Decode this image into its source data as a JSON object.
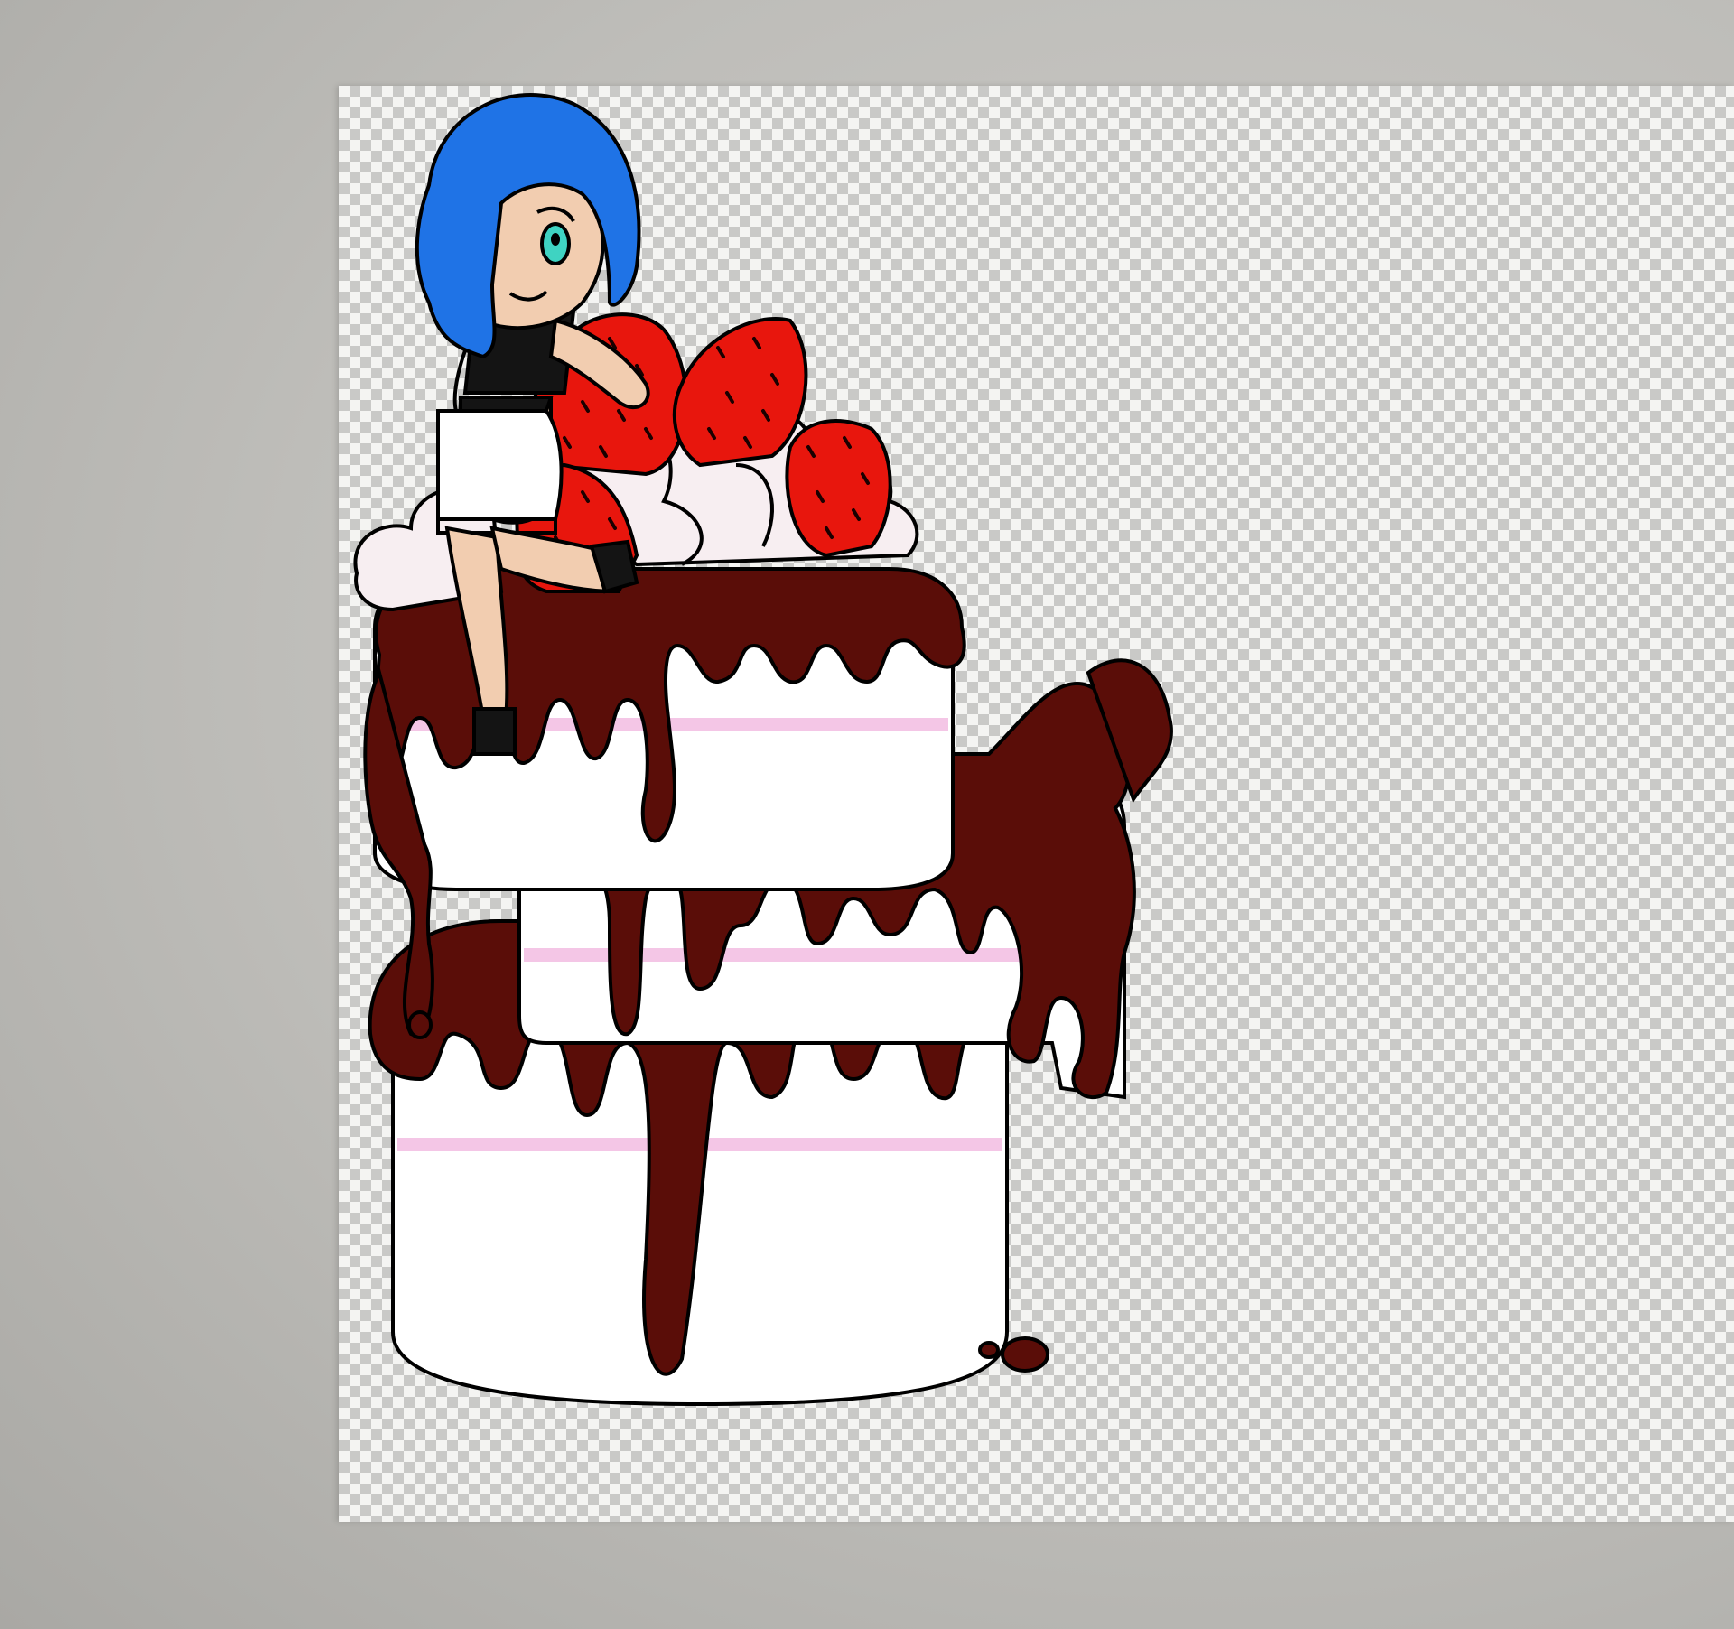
{
  "colors": {
    "workspace": "#bdbcb8",
    "hair": "#1f73e6",
    "skin": "#f2cdb0",
    "eye": "#3fd3c2",
    "top": "#141414",
    "shorts": "#ffffff",
    "chocolate": "#5a0d08",
    "cream": "#ffffff",
    "stripe": "#f4c6e6",
    "strawberry": "#e8160d",
    "seed": "#1a0000",
    "whipped": "#f7eef1"
  },
  "icons": {
    "canvas": "transparency-checkerboard-icon"
  }
}
